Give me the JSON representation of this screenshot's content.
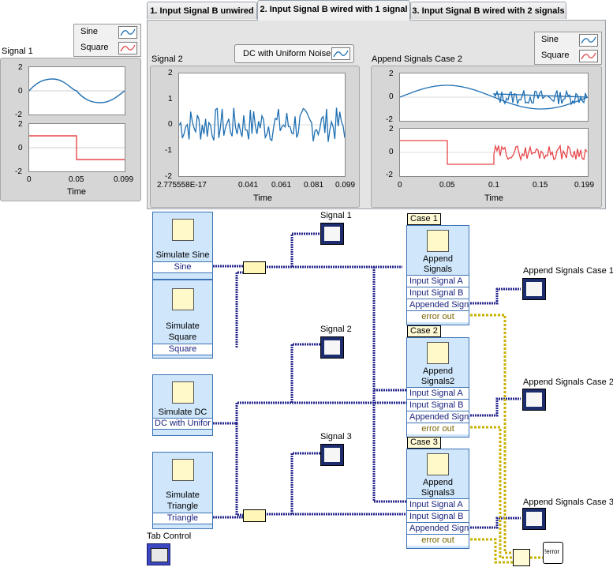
{
  "tabs": [
    {
      "label": "1. Input Signal B unwired"
    },
    {
      "label": "2. Input Signal B wired with 1 signal"
    },
    {
      "label": "3. Input Signal B wired with 2 signals"
    }
  ],
  "signal1_graph": {
    "label": "Signal 1",
    "legend": [
      "Sine",
      "Square"
    ],
    "plot1_yticks": [
      "2",
      "0",
      "-2"
    ],
    "plot2_yticks": [
      "2",
      "0",
      "-2"
    ],
    "xticks": [
      "0",
      "0.05",
      "0.099"
    ],
    "xlabel": "Time"
  },
  "signal2_graph": {
    "label": "Signal 2",
    "legend_button": "DC with Uniform Noise",
    "yticks": [
      "2",
      "1",
      "0",
      "-1",
      "-2"
    ],
    "xticks": [
      "2.775558E-17",
      "0.041",
      "0.061",
      "0.081",
      "0.099"
    ],
    "xlabel": "Time"
  },
  "append_graph": {
    "label": "Append Signals Case 2",
    "legend": [
      "Sine",
      "Square"
    ],
    "plot1_yticks": [
      "2",
      "0",
      "-2"
    ],
    "plot2_yticks": [
      "2",
      "0",
      "-2"
    ],
    "xticks": [
      "0",
      "0.05",
      "0.1",
      "0.15",
      "0.199"
    ],
    "xlabel": "Time"
  },
  "block": {
    "sim_sine": {
      "title": "Simulate Sine",
      "output": "Sine"
    },
    "sim_square": {
      "title_line1": "Simulate",
      "title_line2": "Square",
      "output": "Square"
    },
    "sim_dc": {
      "title": "Simulate DC",
      "output": "DC with Unifor"
    },
    "sim_triangle": {
      "title_line1": "Simulate",
      "title_line2": "Triangle",
      "output": "Triangle"
    },
    "indicators": {
      "signal1": "Signal 1",
      "signal2": "Signal 2",
      "signal3": "Signal 3",
      "case1": "Append Signals Case 1",
      "case2": "Append Signals Case 2",
      "case3": "Append Signals Case 3"
    },
    "cases": [
      {
        "label": "Case 1",
        "title_line1": "Append",
        "title_line2": "Signals"
      },
      {
        "label": "Case 2",
        "title_line1": "Append",
        "title_line2": "Signals2"
      },
      {
        "label": "Case 3",
        "title_line1": "Append",
        "title_line2": "Signals3"
      }
    ],
    "terminals": {
      "input_a": "Input Signal A",
      "input_b": "Input Signal B",
      "appended": "Appended Sign",
      "error_out": "error out"
    },
    "tab_control_label": "Tab Control",
    "error_icon_text": "!error"
  },
  "colors": {
    "sine": "#1f6fb2",
    "square": "#e8474b",
    "wire_dynamic": "#26268c",
    "wire_error": "#c9b100"
  }
}
